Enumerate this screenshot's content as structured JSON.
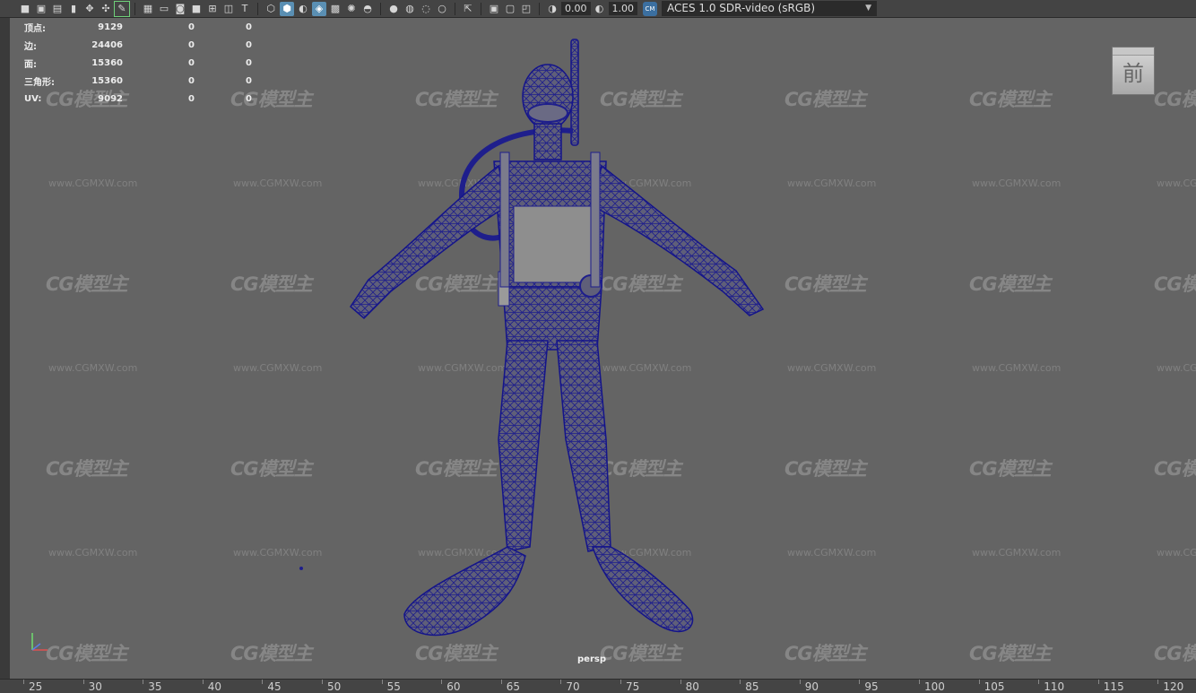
{
  "toolbar": {
    "exposure_value": "0.00",
    "gamma_value": "1.00",
    "color_space_label": "ACES 1.0 SDR-video (sRGB)",
    "icons": [
      "camera-icon",
      "camera-attributes-icon",
      "bookmark-icon",
      "image-plane-icon",
      "2d-pan-icon",
      "grease-pencil-icon",
      "grid-icon",
      "film-gate-icon",
      "resolution-gate-icon",
      "gate-mask-icon",
      "field-chart-icon",
      "safe-action-icon",
      "safe-title-icon",
      "wireframe-icon",
      "smooth-shade-icon",
      "wireframe-on-shaded-icon",
      "xray-icon",
      "use-default-material-icon",
      "textured-icon",
      "lights-icon",
      "shadows-icon",
      "screen-space-ao-icon",
      "motion-blur-icon",
      "anti-aliasing-icon",
      "depth-of-field-icon",
      "isolate-select-icon",
      "xray-active-icon",
      "xray-joints-icon",
      "exposure-icon",
      "gamma-icon",
      "color-management-icon"
    ]
  },
  "hud": {
    "rows": [
      {
        "label": "顶点:",
        "v1": "9129",
        "v2": "0",
        "v3": "0"
      },
      {
        "label": "边:",
        "v1": "24406",
        "v2": "0",
        "v3": "0"
      },
      {
        "label": "面:",
        "v1": "15360",
        "v2": "0",
        "v3": "0"
      },
      {
        "label": "三角形:",
        "v1": "15360",
        "v2": "0",
        "v3": "0"
      },
      {
        "label": "UV:",
        "v1": "9092",
        "v2": "0",
        "v3": "0"
      }
    ]
  },
  "view_cube": {
    "label": "前"
  },
  "camera": {
    "label": "persp"
  },
  "watermark": {
    "logo": "CG模型主",
    "url": "www.CGMXW.com"
  },
  "timeline": {
    "ticks": [
      "25",
      "30",
      "35",
      "40",
      "45",
      "50",
      "55",
      "60",
      "65",
      "70",
      "75",
      "80",
      "85",
      "90",
      "95",
      "100",
      "105",
      "110",
      "115",
      "120"
    ]
  },
  "colors": {
    "viewport_bg": "#646464",
    "wireframe": "#1e1e8c",
    "ui_bg": "#444444"
  }
}
